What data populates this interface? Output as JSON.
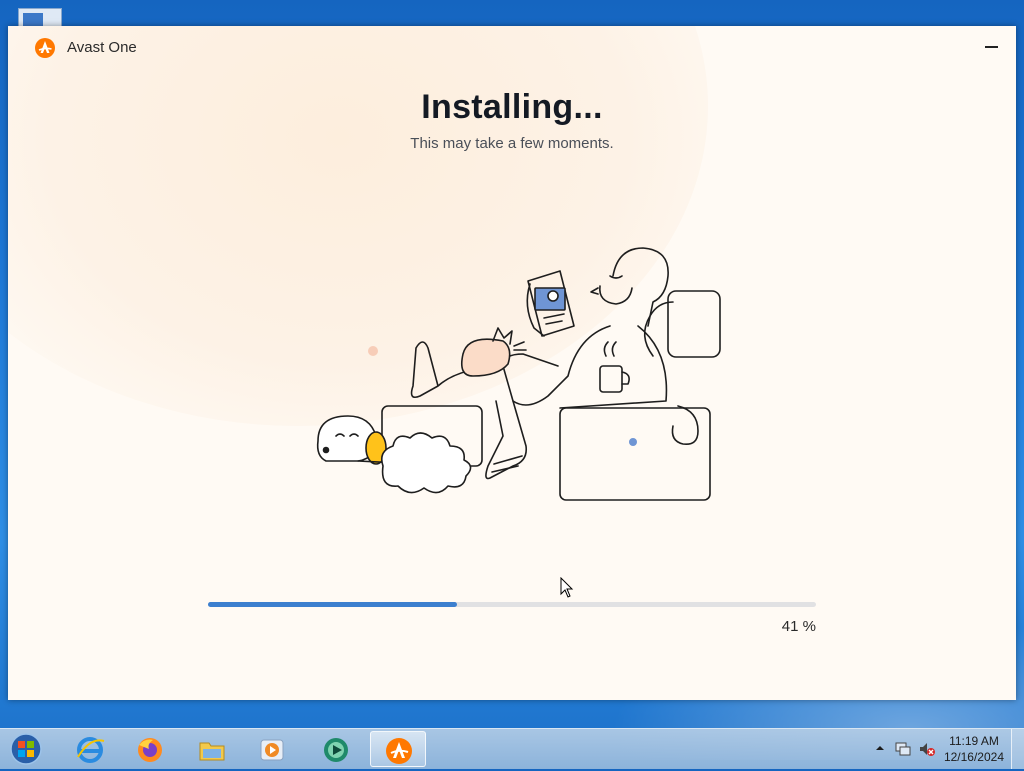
{
  "window": {
    "app_name": "Avast One",
    "heading": "Installing...",
    "subheading": "This may take a few moments."
  },
  "progress": {
    "percent": 41,
    "label": "41 %"
  },
  "taskbar": {
    "items": [
      {
        "name": "Internet Explorer",
        "icon": "ie-icon"
      },
      {
        "name": "Firefox",
        "icon": "firefox-icon"
      },
      {
        "name": "Windows Explorer",
        "icon": "folder-icon"
      },
      {
        "name": "Windows Media Player",
        "icon": "media-player-icon"
      },
      {
        "name": "Media app",
        "icon": "media-app-icon"
      },
      {
        "name": "Avast One",
        "icon": "avast-icon",
        "active": true
      }
    ],
    "clock": {
      "time": "11:19 AM",
      "date": "12/16/2024"
    }
  },
  "colors": {
    "accent": "#3c7fcf",
    "brand": "#ff7800",
    "window_bg": "#fffaf4"
  }
}
